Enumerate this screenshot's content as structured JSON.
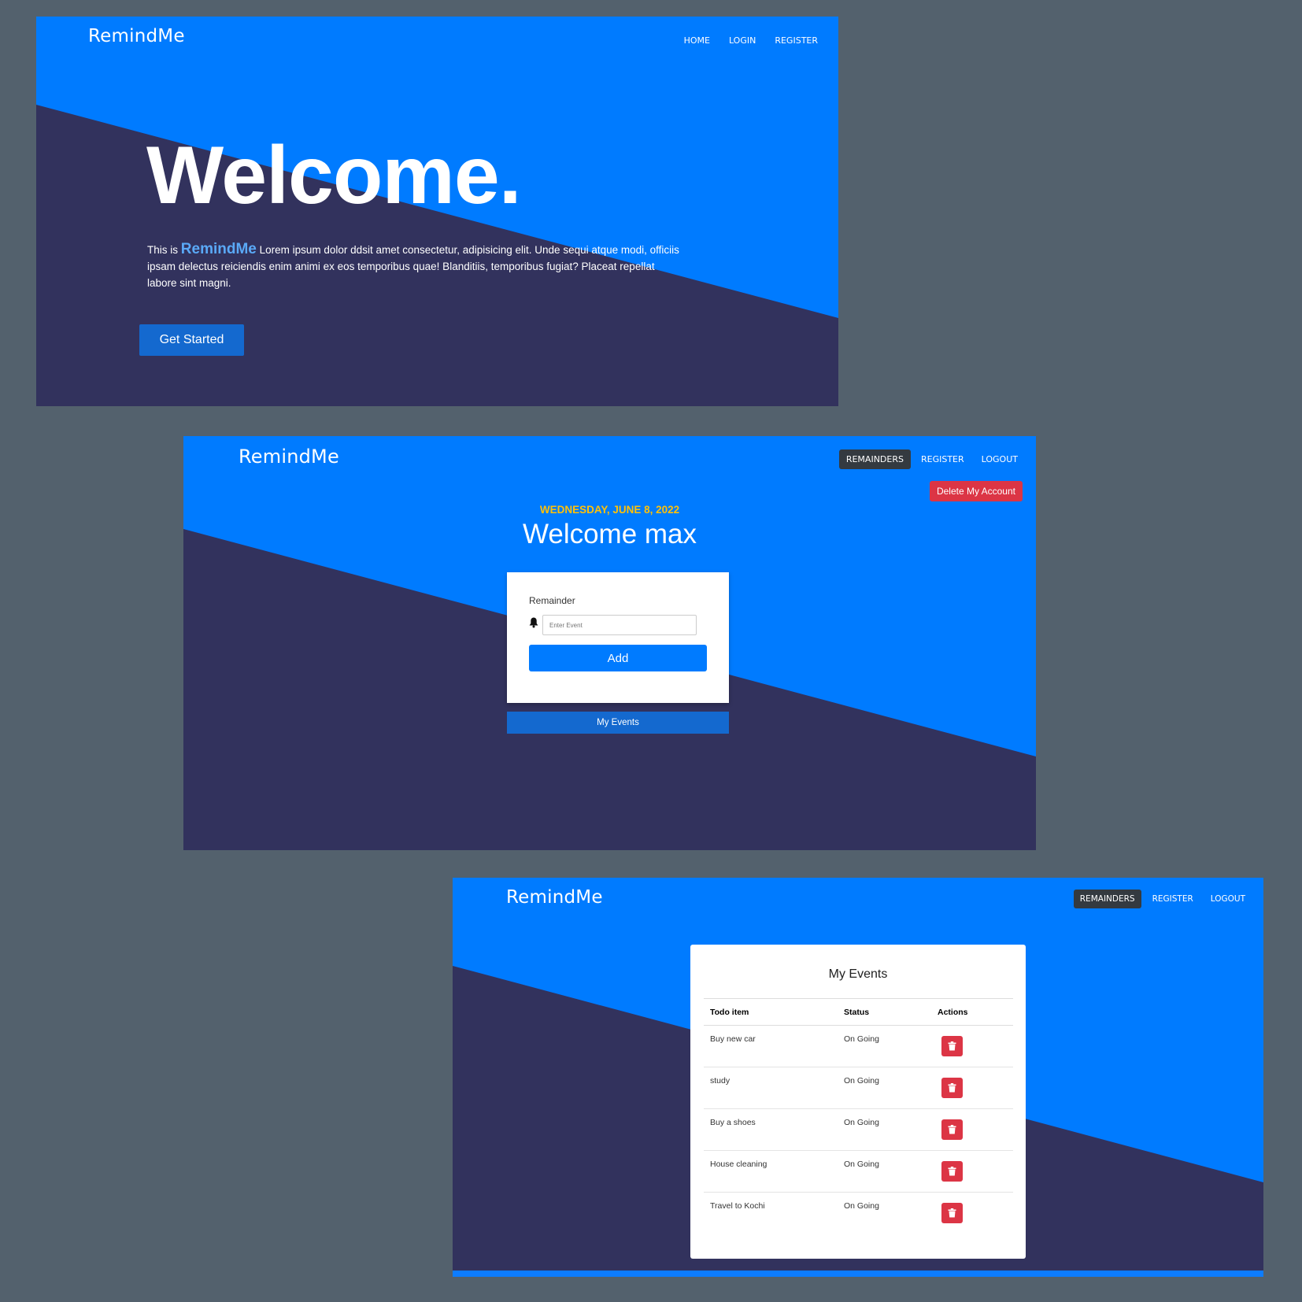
{
  "colors": {
    "primary": "#007bff",
    "dark": "#32325d",
    "danger": "#dc3545",
    "warning": "#ffc107",
    "page_background": "#53616d"
  },
  "landing": {
    "brand": "RemindMe",
    "nav": [
      "HOME",
      "LOGIN",
      "REGISTER"
    ],
    "hero_title": "Welcome.",
    "hero_prefix": "This is",
    "hero_highlight": "RemindMe",
    "hero_body": "Lorem ipsum dolor ddsit amet consectetur, adipisicing elit. Unde sequi atque modi, officiis ipsam delectus reiciendis enim animi ex eos temporibus quae! Blanditiis, temporibus fugiat? Placeat repellat labore sint magni.",
    "cta_label": "Get Started"
  },
  "dashboard": {
    "brand": "RemindMe",
    "nav": [
      "REMAINDERS",
      "REGISTER",
      "LOGOUT"
    ],
    "active_nav": "REMAINDERS",
    "delete_account_label": "Delete My Account",
    "date": "WEDNESDAY, JUNE 8, 2022",
    "welcome": "Welcome max",
    "form": {
      "label": "Remainder",
      "icon": "bell-icon",
      "placeholder": "Enter Event",
      "value": "",
      "add_label": "Add"
    },
    "my_events_label": "My Events"
  },
  "events": {
    "brand": "RemindMe",
    "nav": [
      "REMAINDERS",
      "REGISTER",
      "LOGOUT"
    ],
    "active_nav": "REMAINDERS",
    "title": "My Events",
    "columns": [
      "Todo item",
      "Status",
      "Actions"
    ],
    "action_icon": "trash-icon",
    "rows": [
      {
        "item": "Buy new car",
        "status": "On Going"
      },
      {
        "item": "study",
        "status": "On Going"
      },
      {
        "item": "Buy a shoes",
        "status": "On Going"
      },
      {
        "item": "House cleaning",
        "status": "On Going"
      },
      {
        "item": "Travel to Kochi",
        "status": "On Going"
      }
    ]
  }
}
